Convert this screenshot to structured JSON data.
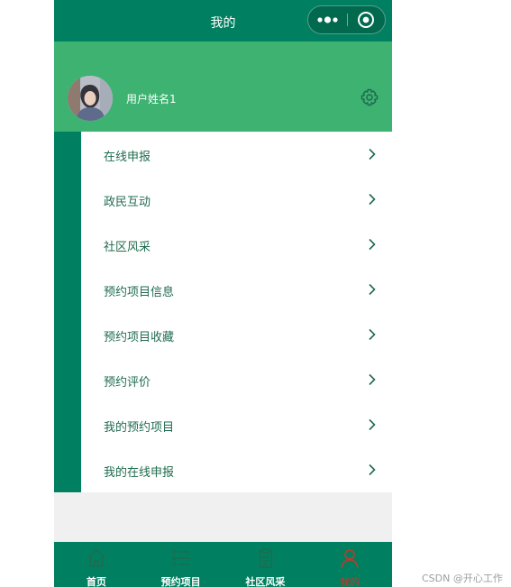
{
  "navbar": {
    "title": "我的"
  },
  "profile": {
    "username": "用户姓名1"
  },
  "menu": {
    "items": [
      {
        "label": "在线申报"
      },
      {
        "label": "政民互动"
      },
      {
        "label": "社区风采"
      },
      {
        "label": "预约项目信息"
      },
      {
        "label": "预约项目收藏"
      },
      {
        "label": "预约评价"
      },
      {
        "label": "我的预约项目"
      },
      {
        "label": "我的在线申报"
      }
    ]
  },
  "tabbar": {
    "items": [
      {
        "label": "首页",
        "icon": "home-icon"
      },
      {
        "label": "预约项目",
        "icon": "list-icon"
      },
      {
        "label": "社区风采",
        "icon": "clipboard-icon"
      },
      {
        "label": "我的",
        "icon": "user-icon",
        "active": true
      }
    ]
  },
  "colors": {
    "primary": "#008060",
    "profile_bg": "#3db271",
    "menu_text": "#1f6b4e",
    "active_tab": "#c0392b"
  },
  "watermark": "CSDN @开心工作室"
}
